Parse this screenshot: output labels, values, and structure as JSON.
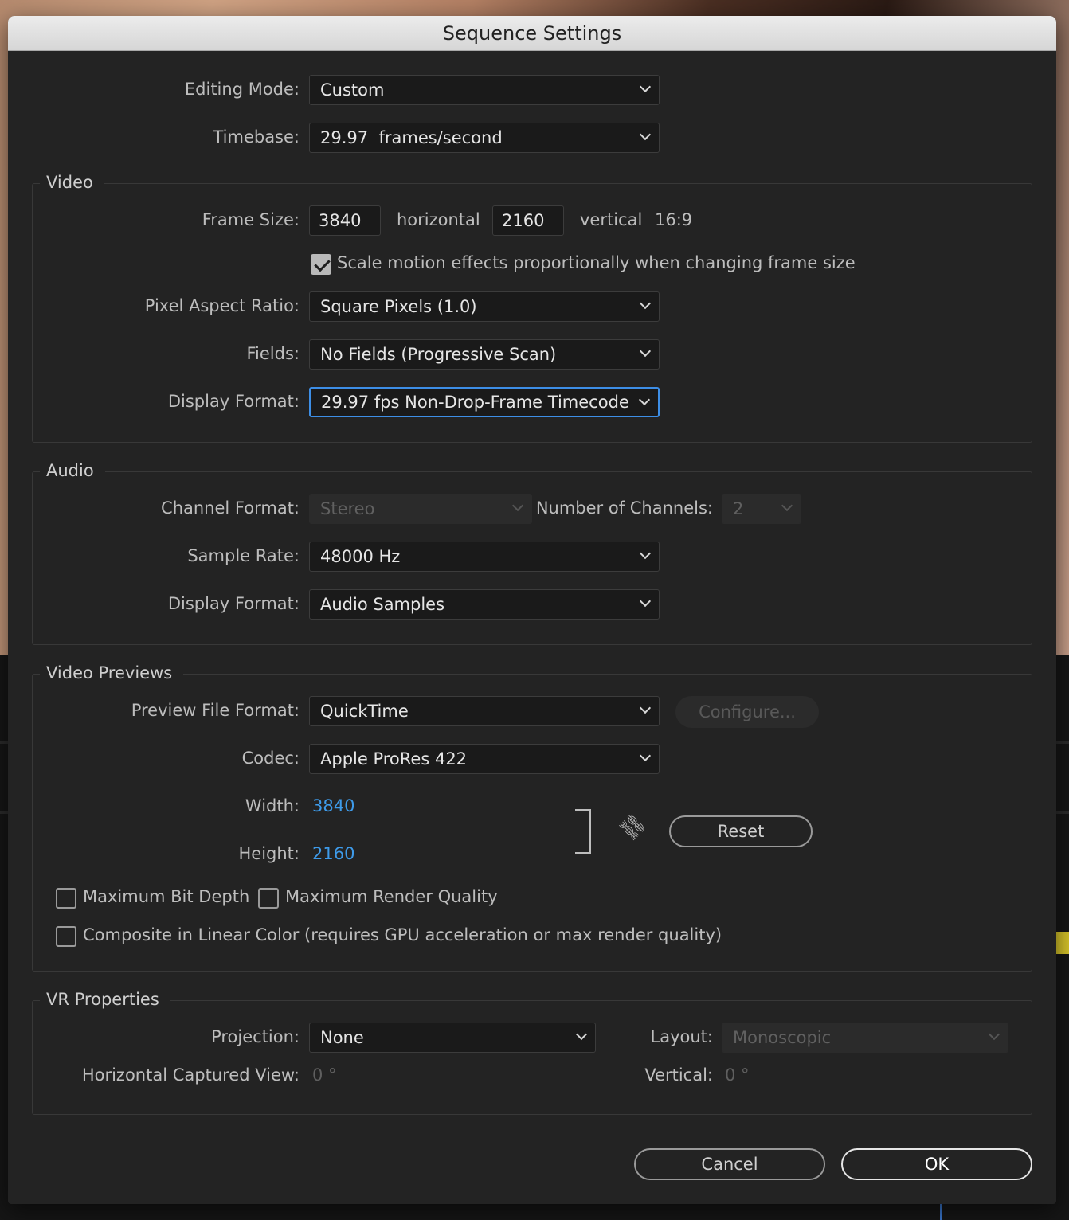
{
  "dialog": {
    "title": "Sequence Settings"
  },
  "general": {
    "editing_mode_label": "Editing Mode:",
    "editing_mode_value": "Custom",
    "timebase_label": "Timebase:",
    "timebase_value": "29.97  frames/second"
  },
  "video": {
    "title": "Video",
    "frame_size_label": "Frame Size:",
    "frame_width": "3840",
    "horizontal_label": "horizontal",
    "frame_height": "2160",
    "vertical_label": "vertical",
    "aspect": "16:9",
    "scale_motion_label": "Scale motion effects proportionally when changing frame size",
    "scale_motion_checked": true,
    "par_label": "Pixel Aspect Ratio:",
    "par_value": "Square Pixels (1.0)",
    "fields_label": "Fields:",
    "fields_value": "No Fields (Progressive Scan)",
    "display_format_label": "Display Format:",
    "display_format_value": "29.97 fps Non-Drop-Frame Timecode"
  },
  "audio": {
    "title": "Audio",
    "channel_format_label": "Channel Format:",
    "channel_format_value": "Stereo",
    "num_channels_label": "Number of Channels:",
    "num_channels_value": "2",
    "sample_rate_label": "Sample Rate:",
    "sample_rate_value": "48000 Hz",
    "display_format_label": "Display Format:",
    "display_format_value": "Audio Samples"
  },
  "previews": {
    "title": "Video Previews",
    "file_format_label": "Preview File Format:",
    "file_format_value": "QuickTime",
    "configure_label": "Configure...",
    "codec_label": "Codec:",
    "codec_value": "Apple ProRes 422",
    "width_label": "Width:",
    "width_value": "3840",
    "height_label": "Height:",
    "height_value": "2160",
    "reset_label": "Reset",
    "max_bit_depth_label": "Maximum Bit Depth",
    "max_render_quality_label": "Maximum Render Quality",
    "linear_color_label": "Composite in Linear Color (requires GPU acceleration or max render quality)"
  },
  "vr": {
    "title": "VR Properties",
    "projection_label": "Projection:",
    "projection_value": "None",
    "layout_label": "Layout:",
    "layout_value": "Monoscopic",
    "h_view_label": "Horizontal Captured View:",
    "h_view_value": "0 °",
    "vertical_label": "Vertical:",
    "vertical_value": "0 °"
  },
  "footer": {
    "cancel_label": "Cancel",
    "ok_label": "OK"
  },
  "colors": {
    "accent": "#3d8ee6",
    "link": "#3e9bea",
    "panel": "#232323"
  }
}
